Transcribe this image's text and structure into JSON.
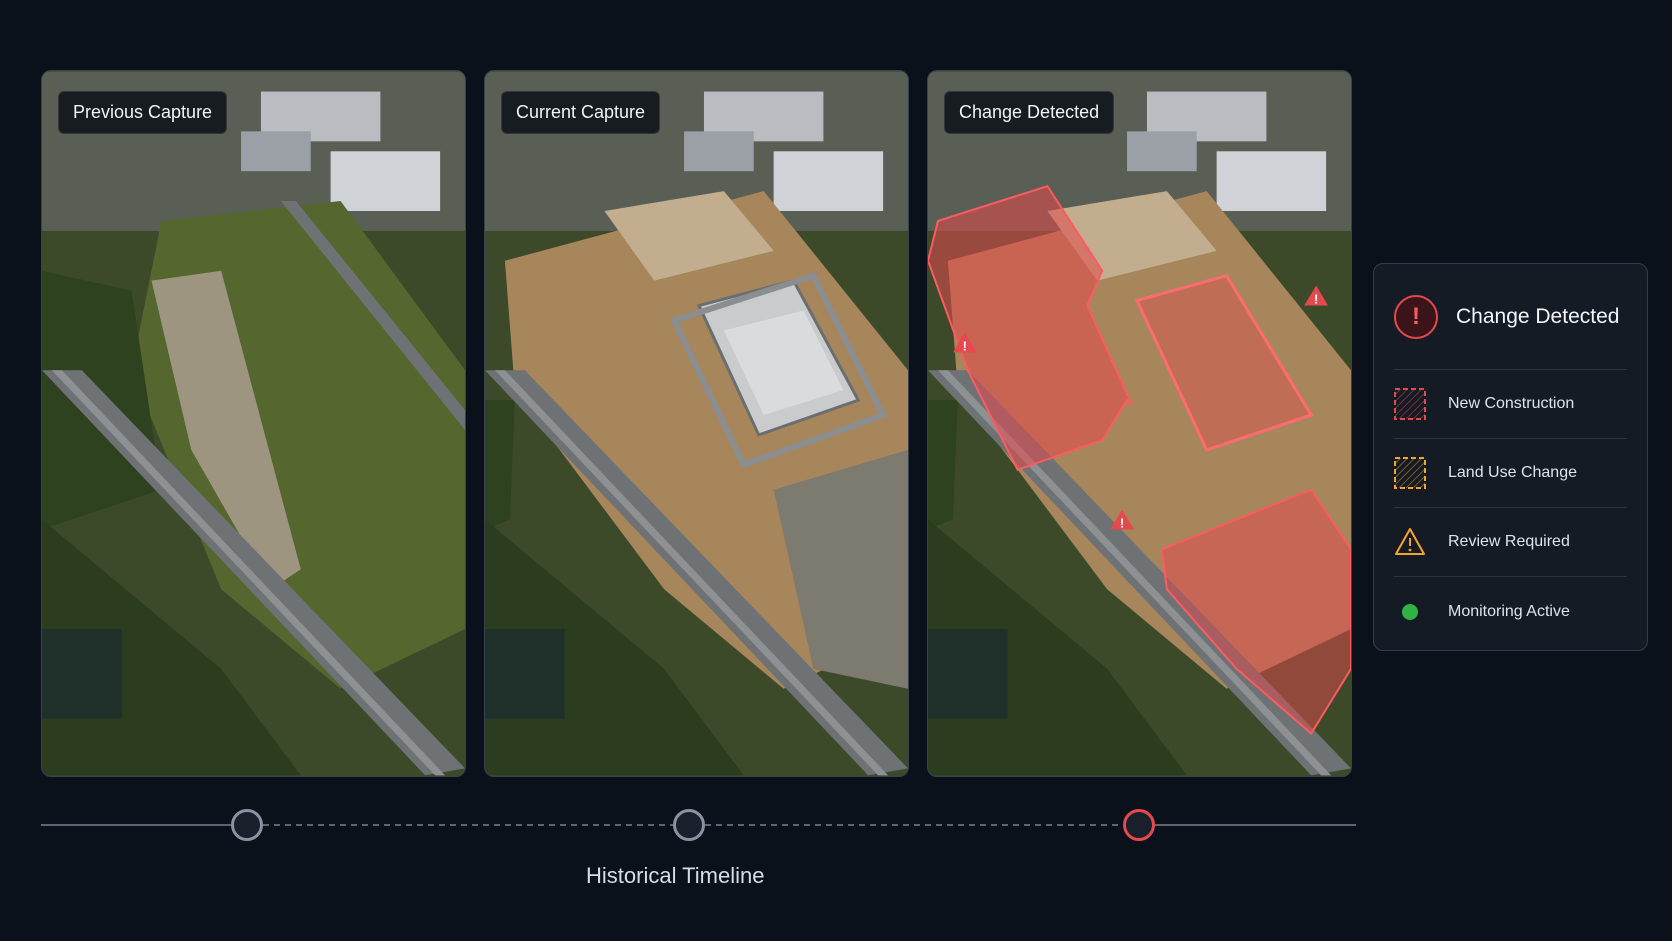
{
  "panels": [
    {
      "label": "Previous Capture"
    },
    {
      "label": "Current Capture"
    },
    {
      "label": "Change Detected"
    }
  ],
  "legend": {
    "title": "Change Detected",
    "alert_icon": "exclamation-icon",
    "items": [
      {
        "label": "New Construction",
        "icon": "dashed-red-hatched-square-icon",
        "color": "#e5484d"
      },
      {
        "label": "Land Use Change",
        "icon": "dashed-orange-hatched-square-icon",
        "color": "#f5a524"
      },
      {
        "label": "Review Required",
        "icon": "warning-triangle-icon",
        "color": "#f5a524"
      },
      {
        "label": "Monitoring Active",
        "icon": "green-dot-icon",
        "color": "#2fb344"
      }
    ]
  },
  "timeline": {
    "title": "Historical Timeline",
    "active_color": "#e5484d",
    "inactive_color": "#8b93a1"
  },
  "colors": {
    "background": "#0b111b",
    "change_overlay": "#e5484d"
  }
}
